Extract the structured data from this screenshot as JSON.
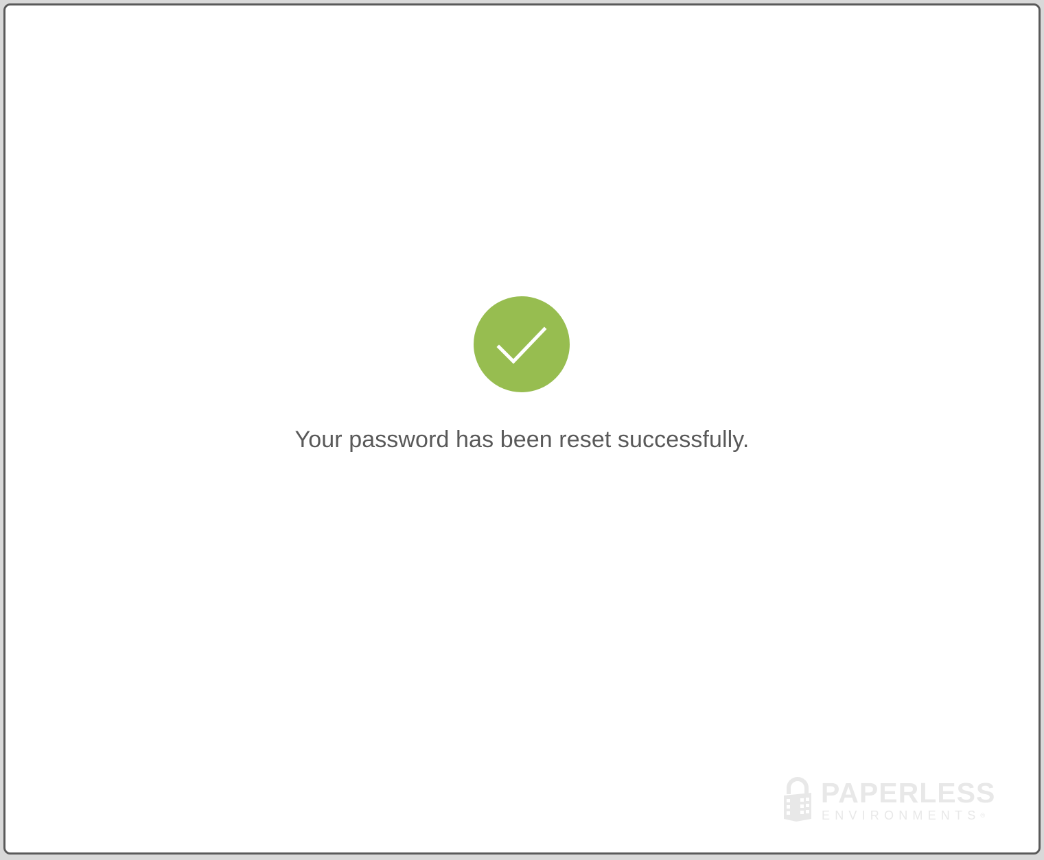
{
  "status": {
    "icon": "check-icon",
    "color": "#97bd50",
    "message": "Your password has been reset successfully."
  },
  "branding": {
    "logo_icon": "padlock-building-icon",
    "name": "PAPERLESS",
    "tagline": "ENVIRONMENTS",
    "registered_mark": "®"
  }
}
